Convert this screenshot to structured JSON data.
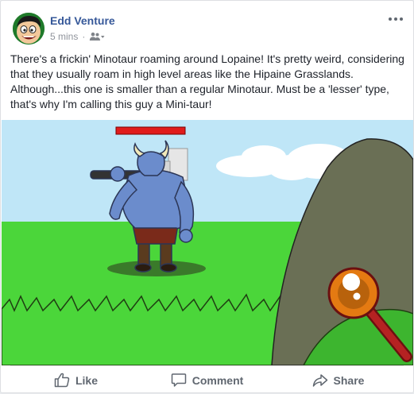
{
  "post": {
    "author": "Edd Venture",
    "time": "5 mins",
    "separator": "·",
    "audience_icon": "friends-icon",
    "text": "There's a frickin' Minotaur roaming around Lopaine! It's pretty weird, considering that they usually roam in high level areas like the Hipaine Grasslands. Although...this one is smaller than a regular Minotaur. Must be a 'lesser' type, that's why I'm calling this guy a Mini-taur!"
  },
  "actions": {
    "like_label": "Like",
    "comment_label": "Comment",
    "share_label": "Share"
  },
  "colors": {
    "author_link": "#365899",
    "meta_gray": "#90949c",
    "action_gray": "#606770",
    "sky": "#bfe6f7",
    "grass": "#4bd63a",
    "minotaur": "#6b8ccc",
    "health_bar": "#e01b1b"
  }
}
